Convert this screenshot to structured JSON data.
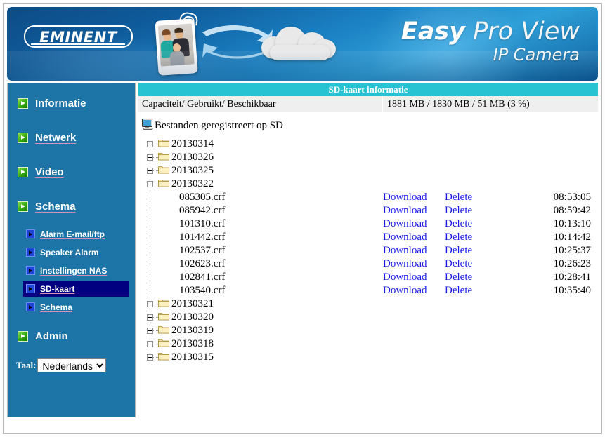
{
  "banner": {
    "logo": "EMINENT",
    "brand_line1_bold": "Easy",
    "brand_line1_thin": "Pro View",
    "brand_line2": "IP Camera",
    "accent_blue": "#1a7fc1"
  },
  "sidebar": {
    "bg_color": "#1c74a7",
    "active_color": "#000080",
    "top_items": [
      {
        "label": "Informatie",
        "icon": "green-arrow-icon"
      },
      {
        "label": "Netwerk",
        "icon": "green-arrow-icon"
      },
      {
        "label": "Video",
        "icon": "green-arrow-icon"
      },
      {
        "label": "Schema",
        "icon": "green-arrow-icon"
      }
    ],
    "sub_items": [
      {
        "label": "Alarm E-mail/ftp",
        "icon": "blue-arrow-icon",
        "active": false
      },
      {
        "label": "Speaker Alarm",
        "icon": "blue-arrow-icon",
        "active": false
      },
      {
        "label": "Instellingen NAS",
        "icon": "blue-arrow-icon",
        "active": false
      },
      {
        "label": "SD-kaart",
        "icon": "blue-arrow-icon",
        "active": true
      },
      {
        "label": "Schema",
        "icon": "blue-arrow-icon",
        "active": false
      }
    ],
    "admin_item": {
      "label": "Admin",
      "icon": "green-arrow-icon"
    },
    "language": {
      "label": "Taal:",
      "selected": "Nederlands",
      "options": [
        "Nederlands"
      ]
    }
  },
  "content": {
    "panel_title": "SD-kaart informatie",
    "header_color": "#27c3d2",
    "capacity_row": {
      "label": "Capaciteit/ Gebruikt/ Beschikbaar",
      "value": "1881 MB / 1830 MB / 51 MB (3 %)"
    },
    "files_heading": "Bestanden geregistreert op SD",
    "tree": [
      {
        "name": "20130314",
        "expanded": false
      },
      {
        "name": "20130326",
        "expanded": false
      },
      {
        "name": "20130325",
        "expanded": false
      },
      {
        "name": "20130322",
        "expanded": true
      },
      {
        "name": "20130321",
        "expanded": false
      },
      {
        "name": "20130320",
        "expanded": false
      },
      {
        "name": "20130319",
        "expanded": false
      },
      {
        "name": "20130318",
        "expanded": false
      },
      {
        "name": "20130315",
        "expanded": false
      }
    ],
    "download_label": "Download",
    "delete_label": "Delete",
    "link_color": "#1a1af0",
    "files": [
      {
        "name": "085305.crf",
        "time": "08:53:05"
      },
      {
        "name": "085942.crf",
        "time": "08:59:42"
      },
      {
        "name": "101310.crf",
        "time": "10:13:10"
      },
      {
        "name": "101442.crf",
        "time": "10:14:42"
      },
      {
        "name": "102537.crf",
        "time": "10:25:37"
      },
      {
        "name": "102623.crf",
        "time": "10:26:23"
      },
      {
        "name": "102841.crf",
        "time": "10:28:41"
      },
      {
        "name": "103540.crf",
        "time": "10:35:40"
      }
    ]
  }
}
